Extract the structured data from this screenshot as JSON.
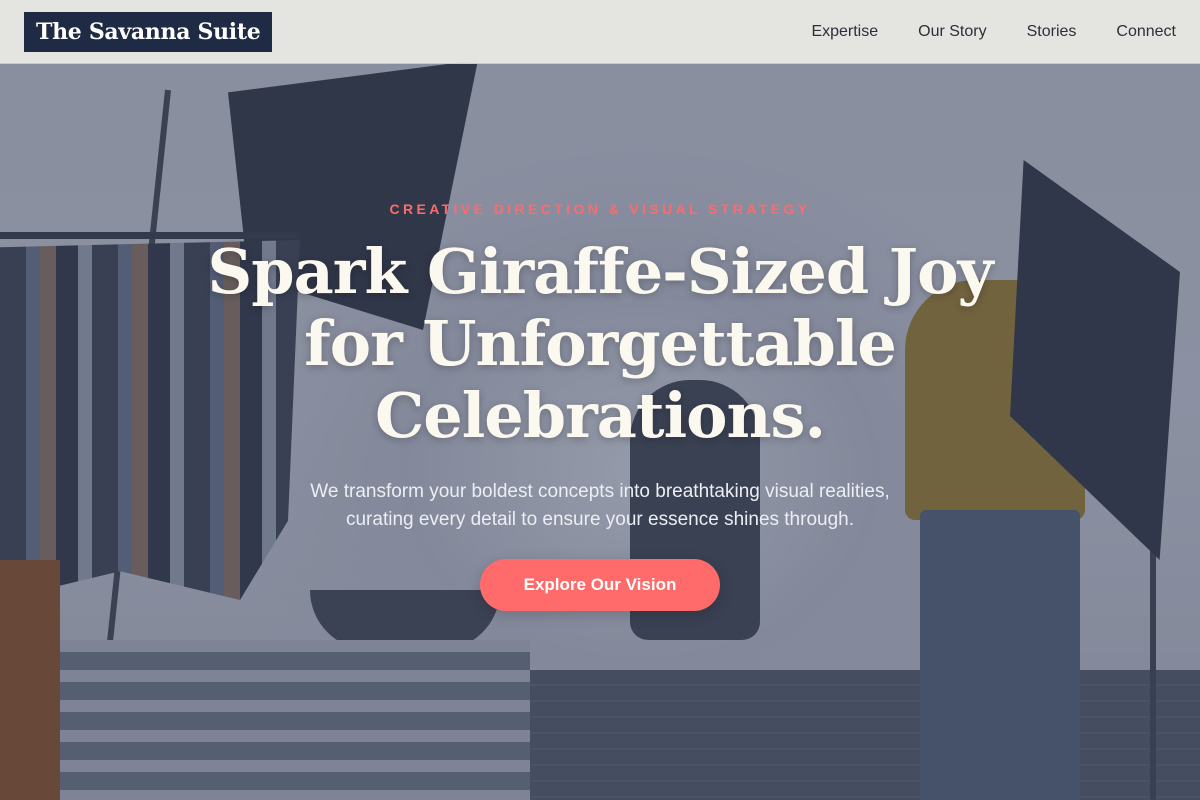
{
  "brand": {
    "name": "The Savanna Suite"
  },
  "nav": {
    "items": [
      {
        "label": "Expertise"
      },
      {
        "label": "Our Story"
      },
      {
        "label": "Stories"
      },
      {
        "label": "Connect"
      }
    ]
  },
  "hero": {
    "eyebrow": "CREATIVE DIRECTION & VISUAL STRATEGY",
    "headline_line1": "Spark Giraffe-Sized Joy",
    "headline_line2": "for Unforgettable",
    "headline_line3": "Celebrations.",
    "subheadline_line1": "We transform your boldest concepts into breathtaking visual realities,",
    "subheadline_line2": "curating every detail to ensure your essence shines through.",
    "cta_label": "Explore Our Vision"
  },
  "colors": {
    "accent": "#ff6b6b",
    "brand_bg": "#1f2a44",
    "navbar_bg": "#e8e7e4",
    "headline_text": "#fbf8f0"
  }
}
